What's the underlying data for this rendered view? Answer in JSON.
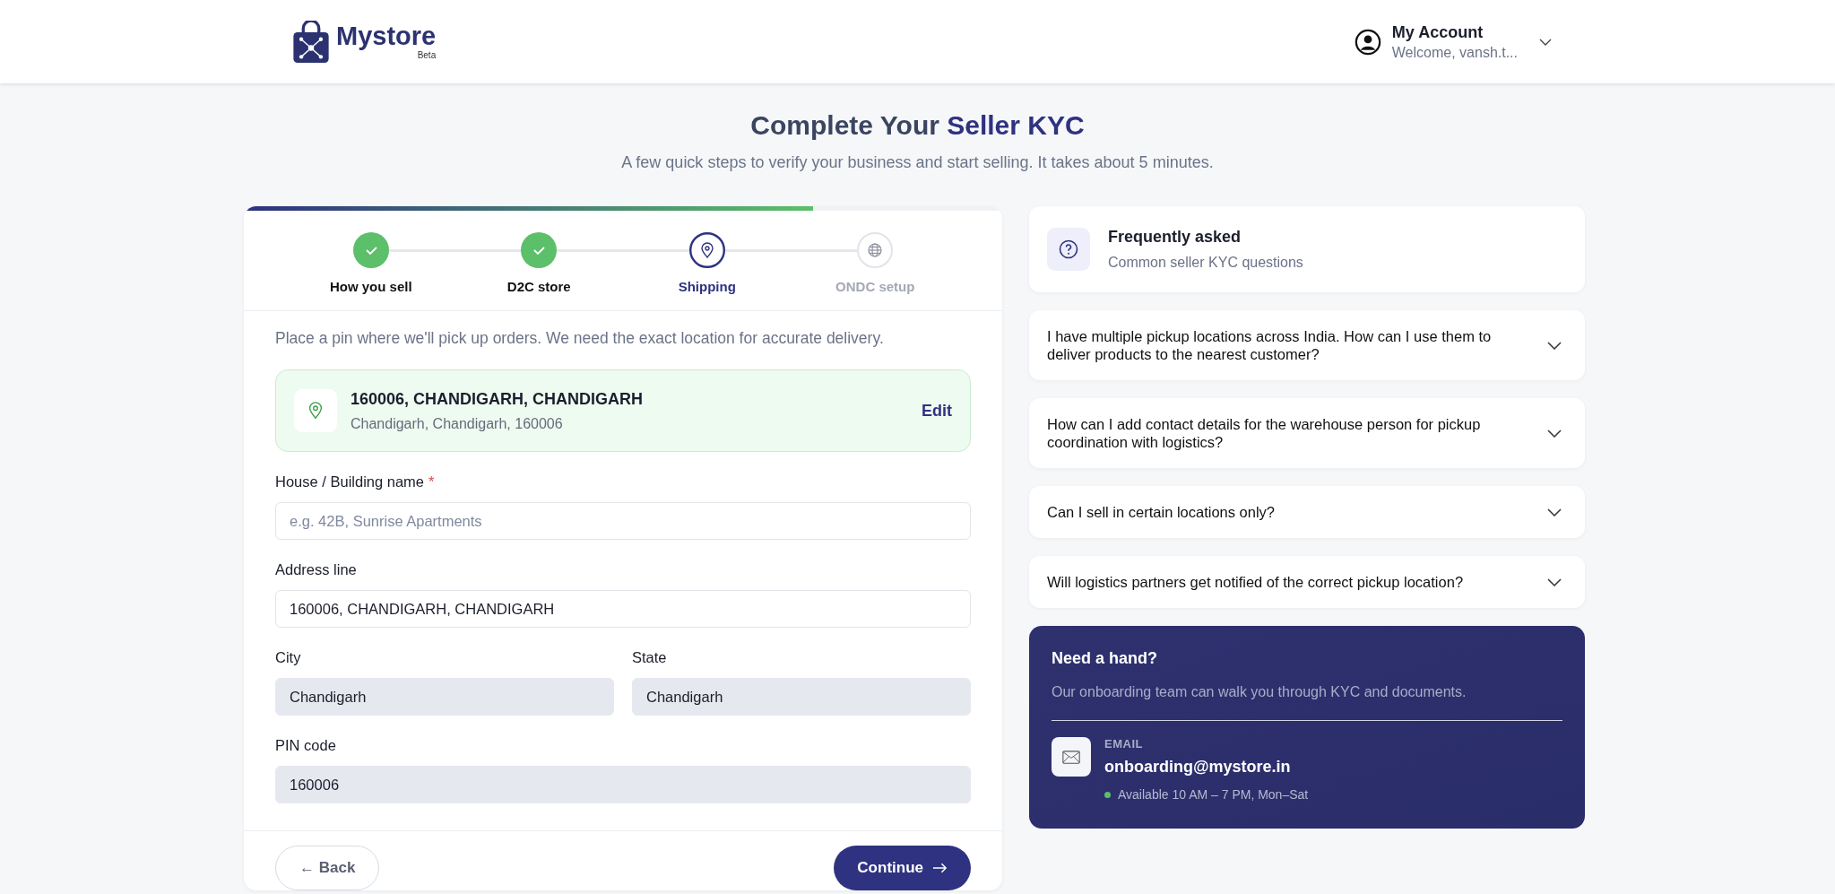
{
  "header": {
    "logo": {
      "name": "Mystore",
      "badge": "Beta"
    },
    "account": {
      "title": "My Account",
      "subtitle": "Welcome, vansh.t..."
    }
  },
  "page": {
    "title": "Complete Your ",
    "title_accent": "Seller KYC",
    "subtitle": "A few quick steps to verify your business and start selling. It takes about 5 minutes."
  },
  "progress": {
    "level": 0.75
  },
  "steps": [
    {
      "label": "How you sell",
      "completed": true,
      "selected": false
    },
    {
      "label": "D2C store",
      "completed": true,
      "selected": false
    },
    {
      "label": "Shipping",
      "completed": false,
      "selected": true
    },
    {
      "label": "ONDC setup",
      "completed": false,
      "selected": false
    }
  ],
  "form": {
    "description": "Place a pin where we'll pick up orders. We need the exact location for accurate delivery.",
    "location": {
      "title": "160006, CHANDIGARH, CHANDIGARH",
      "subtitle": "Chandigarh, Chandigarh, 160006",
      "action": "Edit"
    },
    "rows": [
      [
        {
          "label": "House / Building name",
          "required_mark": "*",
          "placeholder": "e.g. 42B, Sunrise Apartments",
          "readonly": false
        }
      ],
      [
        {
          "label": "Address line",
          "value": "160006, CHANDIGARH, CHANDIGARH",
          "readonly": false
        }
      ],
      [
        {
          "label": "City",
          "value": "Chandigarh",
          "readonly": true
        },
        {
          "label": "State",
          "value": "Chandigarh",
          "readonly": true
        }
      ],
      [
        {
          "label": "PIN code",
          "value": "160006",
          "readonly": true
        }
      ]
    ],
    "back": "← Back",
    "continue": "Continue"
  },
  "faq": {
    "title": "Frequently asked",
    "subtitle": "Common seller KYC questions",
    "items": [
      {
        "question": "I have multiple pickup locations across India. How can I use them to deliver products to the nearest customer?",
        "expanded": false
      },
      {
        "question": "How can I add contact details for the warehouse person for pickup coordination with logistics?",
        "expanded": false
      },
      {
        "question": "Can I sell in certain locations only?",
        "expanded": false
      },
      {
        "question": "Will logistics partners get notified of the correct pickup location?",
        "expanded": false
      }
    ]
  },
  "help": {
    "title": "Need a hand?",
    "text": "Our onboarding team can walk you through KYC and documents.",
    "contact_label": "EMAIL",
    "email": "onboarding@mystore.in",
    "availability": "Available 10 AM – 7 PM, Mon–Sat",
    "online": true
  }
}
